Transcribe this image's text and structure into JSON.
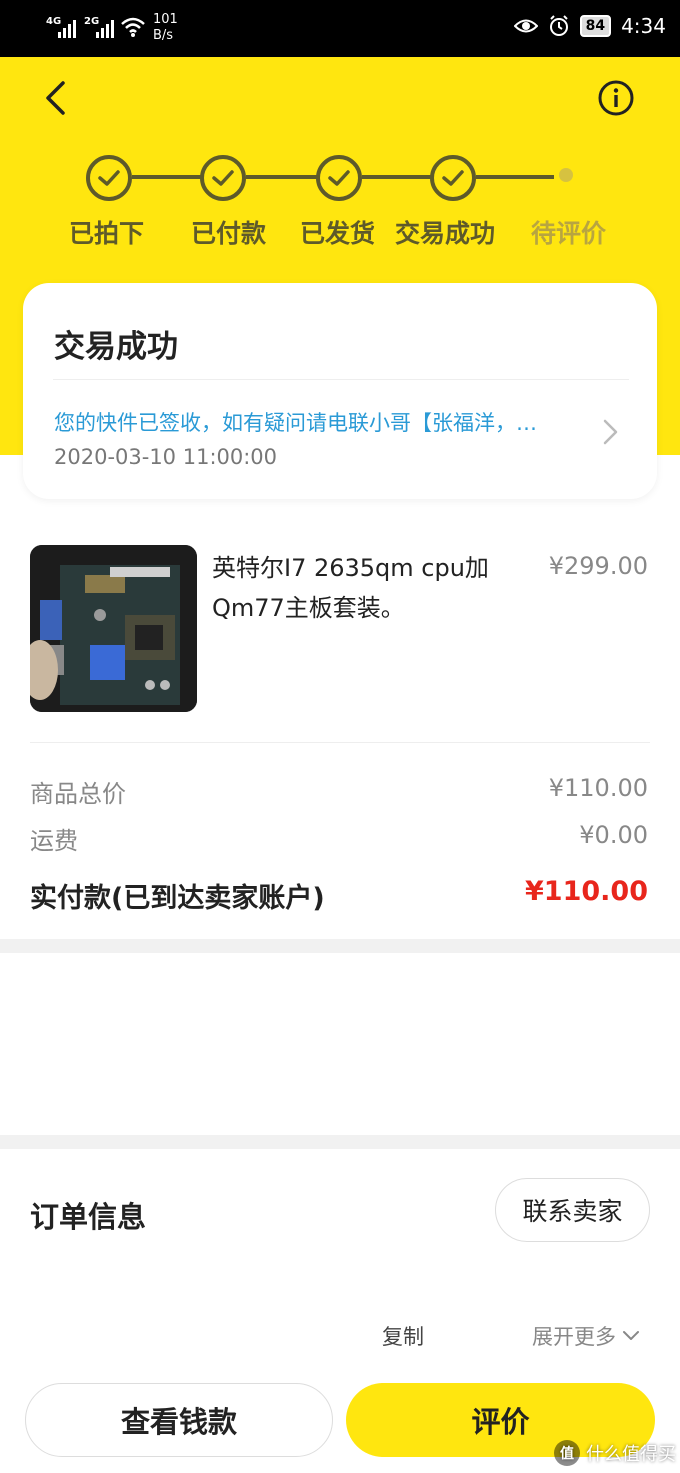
{
  "status_bar": {
    "signal_1": "4G",
    "signal_2": "2G",
    "speed_value": "101",
    "speed_unit": "B/s",
    "battery": "84",
    "time": "4:34"
  },
  "progress": {
    "steps": [
      {
        "label": "已拍下",
        "done": true
      },
      {
        "label": "已付款",
        "done": true
      },
      {
        "label": "已发货",
        "done": true
      },
      {
        "label": "交易成功",
        "done": true
      },
      {
        "label": "待评价",
        "done": false
      }
    ]
  },
  "status_card": {
    "title": "交易成功",
    "message": "您的快件已签收，如有疑问请电联小哥【张福洋，…",
    "time": "2020-03-10 11:00:00"
  },
  "product": {
    "title": "英特尔I7 2635qm cpu加Qm77主板套装。",
    "price": "¥299.00"
  },
  "summary": {
    "goods_total_label": "商品总价",
    "goods_total_value": "¥110.00",
    "shipping_label": "运费",
    "shipping_value": "¥0.00",
    "paid_label": "实付款(已到达卖家账户)",
    "paid_value": "¥110.00"
  },
  "order_info": {
    "title": "订单信息",
    "contact_label": "联系卖家",
    "copy_label": "复制",
    "expand_label": "展开更多"
  },
  "actions": {
    "view_money_label": "查看钱款",
    "rate_label": "评价"
  },
  "watermark": {
    "badge": "值",
    "text": "什么值得买"
  },
  "colors": {
    "brand_yellow": "#ffe60f",
    "step_dark": "#5e5a2a",
    "link_blue": "#2a9ad6",
    "price_red": "#e8261c"
  }
}
